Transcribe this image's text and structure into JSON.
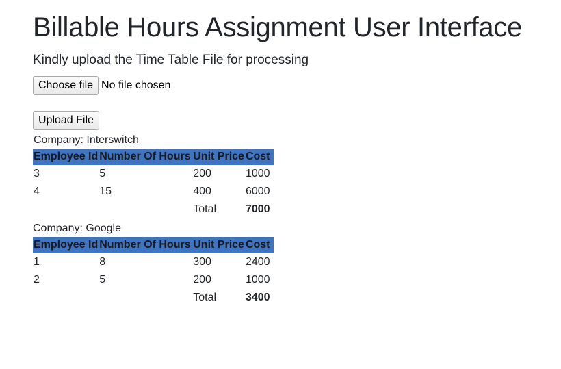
{
  "page": {
    "title": "Billable Hours Assignment User Interface",
    "subtitle": "Kindly upload the Time Table File for processing"
  },
  "file_input": {
    "button_label": "Choose file",
    "status": "No file chosen"
  },
  "upload": {
    "button_label": "Upload File"
  },
  "table_headers": [
    "Employee Id",
    "Number Of Hours",
    "Unit Price",
    "Cost"
  ],
  "companies": [
    {
      "label": "Company: Interswitch",
      "rows": [
        [
          "3",
          "5",
          "200",
          "1000"
        ],
        [
          "4",
          "15",
          "400",
          "6000"
        ]
      ],
      "total_label": "Total",
      "total_value": "7000"
    },
    {
      "label": "Company: Google",
      "rows": [
        [
          "1",
          "8",
          "300",
          "2400"
        ],
        [
          "2",
          "5",
          "200",
          "1000"
        ]
      ],
      "total_label": "Total",
      "total_value": "3400"
    }
  ]
}
